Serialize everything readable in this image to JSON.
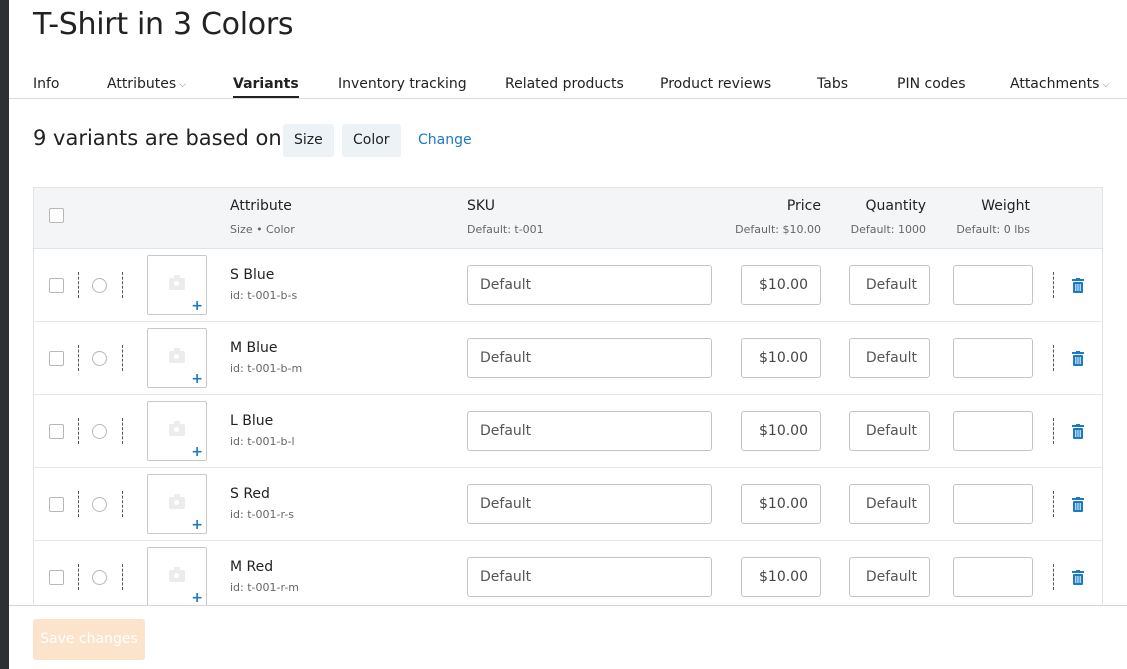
{
  "page": {
    "title": "T-Shirt in 3 Colors"
  },
  "tabs": [
    {
      "label": "Info",
      "active": false
    },
    {
      "label": "Attributes",
      "active": false,
      "has_dropdown": true
    },
    {
      "label": "Variants",
      "active": true
    },
    {
      "label": "Inventory tracking",
      "active": false
    },
    {
      "label": "Related products",
      "active": false
    },
    {
      "label": "Product reviews",
      "active": false
    },
    {
      "label": "Tabs",
      "active": false
    },
    {
      "label": "PIN codes",
      "active": false
    },
    {
      "label": "Attachments",
      "active": false,
      "has_dropdown": true
    }
  ],
  "based_on": {
    "text": "9 variants are based on",
    "chips": [
      "Size",
      "Color"
    ],
    "change_label": "Change"
  },
  "table": {
    "headers": {
      "attribute": "Attribute",
      "attribute_sub": "Size • Color",
      "sku": "SKU",
      "sku_sub": "Default: t-001",
      "price": "Price",
      "price_sub": "Default: $10.00",
      "quantity": "Quantity",
      "quantity_sub": "Default: 1000",
      "weight": "Weight",
      "weight_sub": "Default: 0 lbs"
    },
    "rows": [
      {
        "name": "S Blue",
        "id": "id: t-001-b-s",
        "sku_placeholder": "Default",
        "price": "$10.00",
        "quantity_placeholder": "Default",
        "weight": ""
      },
      {
        "name": "M Blue",
        "id": "id: t-001-b-m",
        "sku_placeholder": "Default",
        "price": "$10.00",
        "quantity_placeholder": "Default",
        "weight": ""
      },
      {
        "name": "L Blue",
        "id": "id: t-001-b-l",
        "sku_placeholder": "Default",
        "price": "$10.00",
        "quantity_placeholder": "Default",
        "weight": ""
      },
      {
        "name": "S Red",
        "id": "id: t-001-r-s",
        "sku_placeholder": "Default",
        "price": "$10.00",
        "quantity_placeholder": "Default",
        "weight": ""
      },
      {
        "name": "M Red",
        "id": "id: t-001-r-m",
        "sku_placeholder": "Default",
        "price": "$10.00",
        "quantity_placeholder": "Default",
        "weight": ""
      }
    ]
  },
  "footer": {
    "save_label": "Save changes"
  },
  "colors": {
    "link": "#1a7ac2",
    "save_button_disabled": "#fbe3cc",
    "chip_bg": "#edf2f6"
  },
  "icons": {
    "image_placeholder": "camera-icon",
    "add_image": "plus-icon",
    "delete": "trash-icon"
  }
}
